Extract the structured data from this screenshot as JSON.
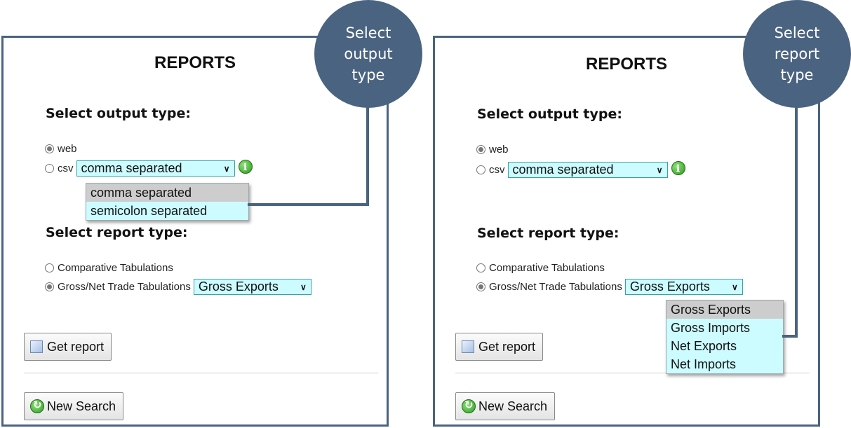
{
  "left": {
    "title": "REPORTS",
    "output_heading": "Select output type:",
    "radio_web": "web",
    "radio_csv": "csv",
    "csv_select_value": "comma separated",
    "info_glyph": "i",
    "csv_options": [
      "comma separated",
      "semicolon separated"
    ],
    "report_heading": "Select report type:",
    "radio_comparative": "Comparative Tabulations",
    "radio_grossnet": "Gross/Net Trade Tabulations",
    "report_select_value": "Gross Exports",
    "get_report": "Get report",
    "new_search": "New Search",
    "callout": [
      "Select",
      "output",
      "type"
    ]
  },
  "right": {
    "title": "REPORTS",
    "output_heading": "Select output type:",
    "radio_web": "web",
    "radio_csv": "csv",
    "csv_select_value": "comma separated",
    "info_glyph": "i",
    "report_heading": "Select report type:",
    "radio_comparative": "Comparative Tabulations",
    "radio_grossnet": "Gross/Net Trade Tabulations",
    "report_select_value": "Gross Exports",
    "report_options": [
      "Gross Exports",
      "Gross Imports",
      "Net Exports",
      "Net Imports"
    ],
    "get_report": "Get report",
    "new_search": "New Search",
    "callout": [
      "Select",
      "report",
      "type"
    ]
  },
  "colors": {
    "callout": "#4a6380",
    "select_bg": "#ccfcff",
    "selected_option": "#cdcdcd"
  },
  "icons": {
    "info": "info-icon",
    "get_report": "document-icon",
    "new_search": "refresh-icon",
    "select_arrow": "chevron-down-icon"
  },
  "state": {
    "left_output_selected": "web",
    "left_report_selected": "Gross/Net Trade Tabulations",
    "right_output_selected": "web",
    "right_report_selected": "Gross/Net Trade Tabulations"
  }
}
